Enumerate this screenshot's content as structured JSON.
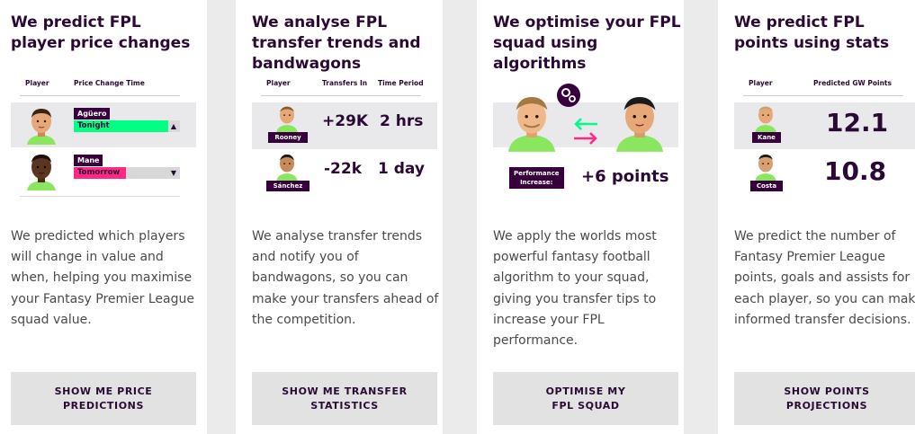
{
  "cards": [
    {
      "title": "We predict FPL player price changes",
      "headers": [
        "Player",
        "Price Change Time"
      ],
      "rows": [
        {
          "name": "Agüero",
          "status": "Tonight",
          "status_color": "#00ff85",
          "arrow": "▲"
        },
        {
          "name": "Mane",
          "status": "Tomorrow",
          "status_color": "#ff2882",
          "arrow": "▼"
        }
      ],
      "body": "We predicted which players will change in value and when, helping you maximise your Fantasy Premier League squad value.",
      "cta": "SHOW ME PRICE\nPREDICTIONS"
    },
    {
      "title": "We analyse FPL transfer trends and bandwagons",
      "headers": [
        "Player",
        "Transfers In",
        "Time Period"
      ],
      "rows": [
        {
          "name": "Rooney",
          "transfers": "+29K",
          "period": "2 hrs"
        },
        {
          "name": "Sánchez",
          "transfers": "-22k",
          "period": "1 day"
        }
      ],
      "body": "We analyse transfer trends and notify you of bandwagons, so you can make your transfers ahead of the competition.",
      "cta": "SHOW ME TRANSFER\nSTATISTICS"
    },
    {
      "title": "We optimise your FPL squad using algorithms",
      "tag": "Performance\nIncrease:",
      "gain": "+6 points",
      "body": "We apply the worlds most powerful fantasy football algorithm to your squad, giving you transfer tips to increase your FPL performance.",
      "cta": "OPTIMISE MY\nFPL SQUAD"
    },
    {
      "title": "We predict FPL points using stats",
      "headers": [
        "Player",
        "Predicted GW Points"
      ],
      "rows": [
        {
          "name": "Kane",
          "points": "12.1"
        },
        {
          "name": "Costa",
          "points": "10.8"
        }
      ],
      "body": "We predict the number of Fantasy Premier League points, goals and assists for each player, so you can make informed transfer decisions.",
      "cta": "SHOW POINTS\nPROJECTIONS"
    }
  ],
  "colors": {
    "brand_purple": "#37003c",
    "green": "#00ff85",
    "pink": "#ff2882",
    "button_bg": "#e2e2e2"
  }
}
